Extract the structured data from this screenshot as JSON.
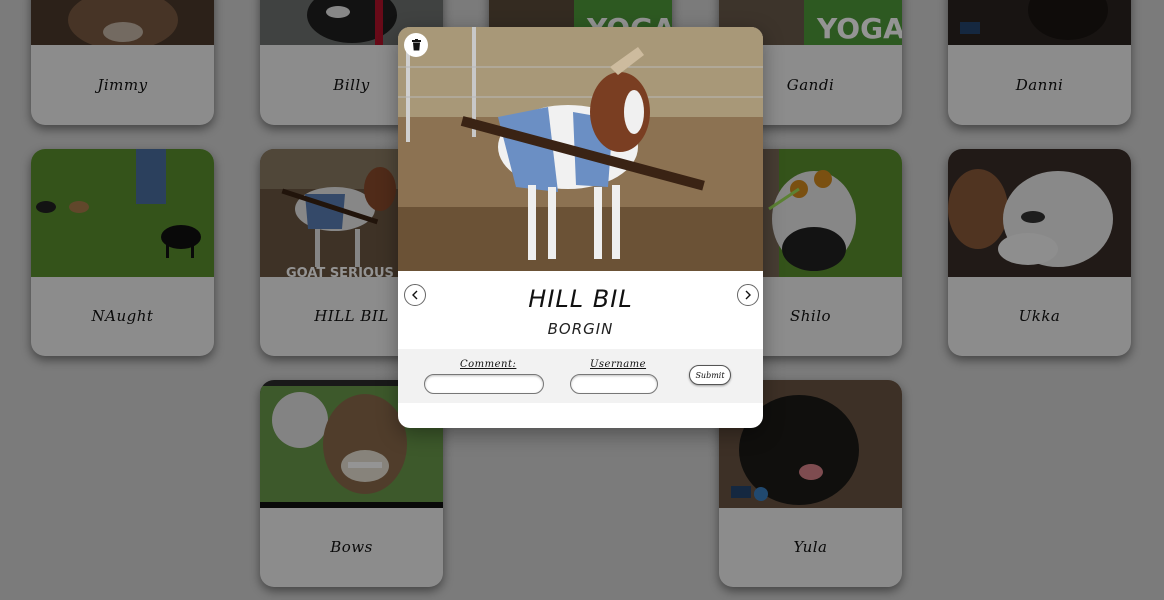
{
  "cards": [
    {
      "name": "Jimmy"
    },
    {
      "name": "Billy"
    },
    {
      "name": "Gandi"
    },
    {
      "name": "Danni"
    },
    {
      "name": "NAught"
    },
    {
      "name": "HILL BIL"
    },
    {
      "name": "Shilo"
    },
    {
      "name": "Ukka"
    },
    {
      "name": "Bows"
    },
    {
      "name": "Yula"
    }
  ],
  "banner_text": {
    "yoga": "YOGA",
    "goat_serious": "GOAT SERIOUS"
  },
  "modal": {
    "title": "HILL BIL",
    "subtitle": "BORGIN",
    "comment_label": "Comment:",
    "username_label": "Username",
    "submit_label": "Submit",
    "comment_value": "",
    "username_value": ""
  },
  "icons": {
    "trash": "trash-icon",
    "prev": "chevron-left-icon",
    "next": "chevron-right-icon"
  },
  "colors": {
    "overlay": "#000000",
    "card_bg": "#f2f2f2",
    "grass": "#5a8f2e",
    "yoga_banner": "#4f9a3a"
  }
}
